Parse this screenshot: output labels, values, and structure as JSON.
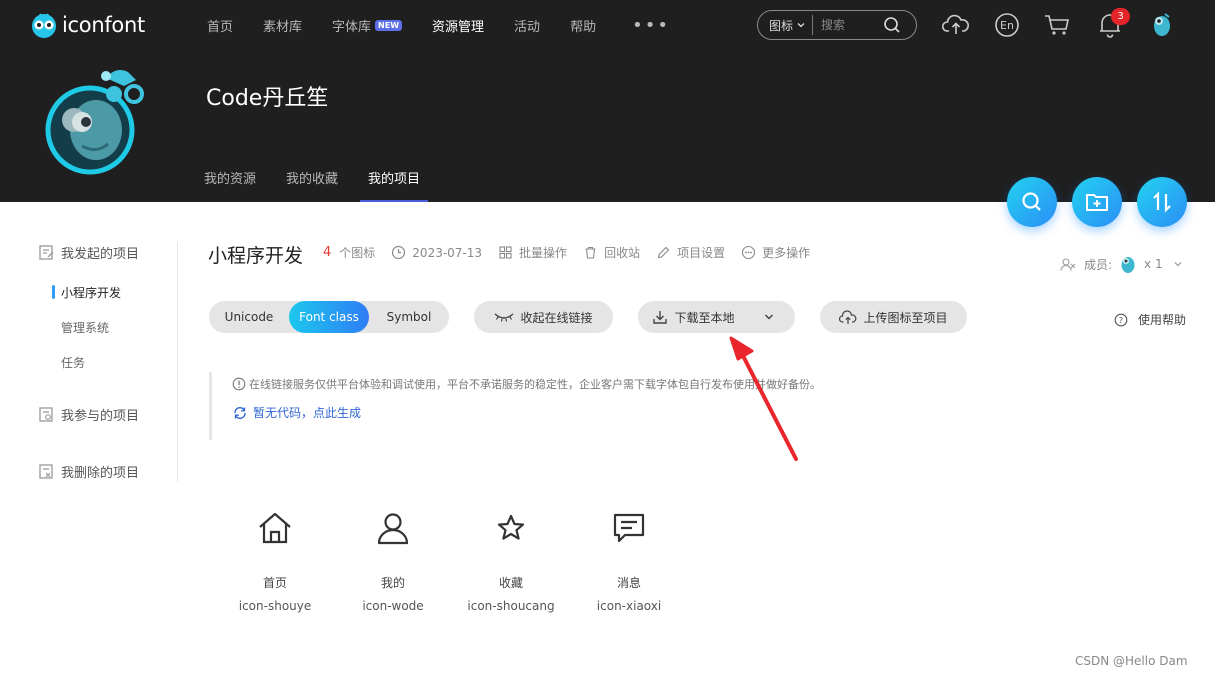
{
  "header": {
    "logo_text": "iconfont",
    "nav": [
      {
        "label": "首页"
      },
      {
        "label": "素材库"
      },
      {
        "label": "字体库",
        "badge": "NEW"
      },
      {
        "label": "资源管理",
        "active": true
      },
      {
        "label": "活动"
      },
      {
        "label": "帮助"
      }
    ],
    "more_label": "•••",
    "search": {
      "type_label": "图标",
      "placeholder": "搜索"
    },
    "notification_count": "3",
    "icons": [
      "upload-cloud-icon",
      "language-en-icon",
      "cart-icon",
      "bell-icon",
      "user-avatar-icon"
    ]
  },
  "profile": {
    "name": "Code丹丘笙",
    "tabs": [
      {
        "label": "我的资源"
      },
      {
        "label": "我的收藏"
      },
      {
        "label": "我的项目",
        "active": true
      }
    ]
  },
  "floating_buttons": [
    "search-icon",
    "add-folder-icon",
    "sort-icon"
  ],
  "sidebar": {
    "groups": [
      {
        "label": "我发起的项目",
        "items": [
          "小程序开发",
          "管理系统",
          "任务"
        ],
        "active_item": "小程序开发"
      },
      {
        "label": "我参与的项目",
        "items": []
      },
      {
        "label": "我删除的项目",
        "items": []
      }
    ]
  },
  "project": {
    "title": "小程序开发",
    "icon_count": "4",
    "icon_count_suffix": "个图标",
    "date": "2023-07-13",
    "actions": [
      "批量操作",
      "回收站",
      "项目设置",
      "更多操作"
    ],
    "members_label": "成员:",
    "members_count": "x 1"
  },
  "toolbar": {
    "formats": [
      "Unicode",
      "Font class",
      "Symbol"
    ],
    "selected_format": "Font class",
    "collapse_link_label": "收起在线链接",
    "download_label": "下载至本地",
    "upload_label": "上传图标至项目",
    "help_label": "使用帮助"
  },
  "notice": {
    "text": "在线链接服务仅供平台体验和调试使用，平台不承诺服务的稳定性，企业客户需下载字体包自行发布使用并做好备份。",
    "link_label": "暂无代码，点此生成"
  },
  "icons": [
    {
      "name_cn": "首页",
      "class": "icon-shouye",
      "glyph": "home-icon"
    },
    {
      "name_cn": "我的",
      "class": "icon-wode",
      "glyph": "user-icon"
    },
    {
      "name_cn": "收藏",
      "class": "icon-shoucang",
      "glyph": "star-icon"
    },
    {
      "name_cn": "消息",
      "class": "icon-xiaoxi",
      "glyph": "message-icon"
    }
  ],
  "watermark": "CSDN @Hello Dam",
  "colors": {
    "header_bg": "#1f1f1f",
    "accent_blue": "#2f7df5",
    "accent_cyan": "#1cc8ee",
    "badge_red": "#e52429",
    "arrow_red": "#e8262b"
  }
}
